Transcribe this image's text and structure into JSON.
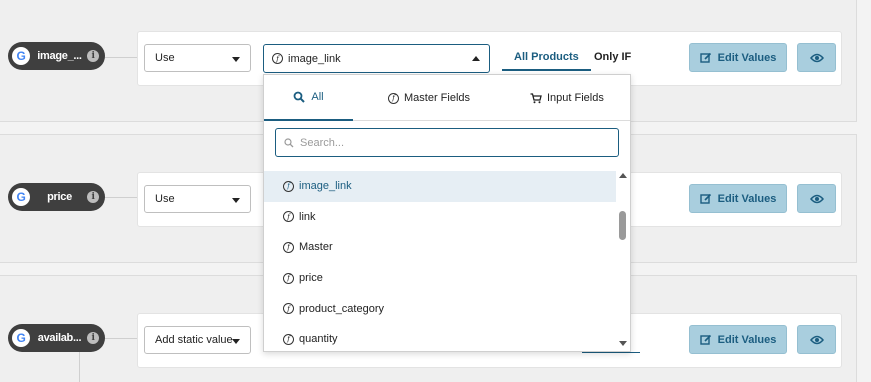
{
  "rows": [
    {
      "field_name": "image_...",
      "action": "Use"
    },
    {
      "field_name": "price",
      "action": "Use"
    },
    {
      "field_name": "availab...",
      "action": "Add static value"
    }
  ],
  "google_letter": "G",
  "info_glyph": "i",
  "fx_glyph": "f",
  "edit_values_label": "Edit Values",
  "scope_tabs": {
    "all_products": "All Products",
    "only_if": "Only IF"
  },
  "field_select": {
    "value": "image_link"
  },
  "dropdown": {
    "tabs": [
      {
        "label": "All",
        "icon": "search-icon"
      },
      {
        "label": "Master Fields",
        "icon": "function-icon"
      },
      {
        "label": "Input Fields",
        "icon": "cart-icon"
      }
    ],
    "search_placeholder": "Search...",
    "items": [
      "image_link",
      "link",
      "Master",
      "price",
      "product_category",
      "quantity"
    ],
    "selected_index": 0
  },
  "colors": {
    "accent": "#1b5d80",
    "button_bg": "#a9cede",
    "pill_bg": "#3f3f3f"
  }
}
